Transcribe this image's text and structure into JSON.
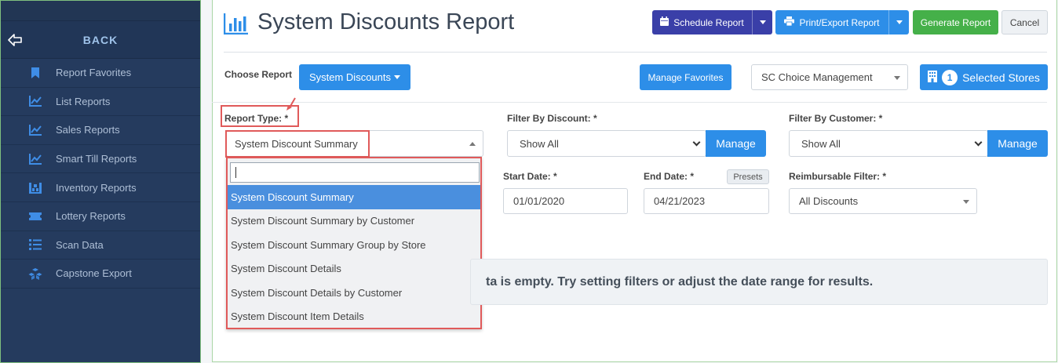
{
  "sidebar": {
    "back_label": "BACK",
    "items": [
      {
        "label": "Report Favorites",
        "icon": "bookmark-icon"
      },
      {
        "label": "List Reports",
        "icon": "line-chart-icon"
      },
      {
        "label": "Sales Reports",
        "icon": "line-chart-icon"
      },
      {
        "label": "Smart Till Reports",
        "icon": "line-chart-icon"
      },
      {
        "label": "Inventory Reports",
        "icon": "warehouse-icon"
      },
      {
        "label": "Lottery Reports",
        "icon": "ticket-icon"
      },
      {
        "label": "Scan Data",
        "icon": "list-icon"
      },
      {
        "label": "Capstone Export",
        "icon": "cubes-icon"
      }
    ]
  },
  "header": {
    "title": "System Discounts Report",
    "schedule_label": "Schedule Report",
    "print_label": "Print/Export Report",
    "generate_label": "Generate Report",
    "cancel_label": "Cancel"
  },
  "choose": {
    "label": "Choose Report",
    "selected": "System Discounts",
    "manage_favorites": "Manage Favorites",
    "management": "SC Choice Management",
    "selected_stores_count": "1",
    "selected_stores_label": "Selected Stores"
  },
  "filters": {
    "report_type_label": "Report Type: *",
    "report_type_value": "System Discount Summary",
    "dropdown_options": [
      "System Discount Summary",
      "System Discount Summary by Customer",
      "System Discount Summary Group by Store",
      "System Discount Details",
      "System Discount Details by Customer",
      "System Discount Item Details"
    ],
    "discount_label": "Filter By Discount: *",
    "discount_value": "Show All",
    "customer_label": "Filter By Customer: *",
    "customer_value": "Show All",
    "manage_label": "Manage",
    "start_label": "Start Date: *",
    "start_value": "01/01/2020",
    "end_label": "End Date: *",
    "end_value": "04/21/2023",
    "presets_label": "Presets",
    "reimb_label": "Reimbursable Filter: *",
    "reimb_value": "All Discounts"
  },
  "empty_message": "ta is empty. Try setting filters or adjust the date range for results.",
  "colors": {
    "sidebar_bg": "#253b5e",
    "primary": "#2d8ee8",
    "schedule": "#3a3fa8",
    "generate": "#45b049",
    "highlight": "#e05a5a"
  }
}
